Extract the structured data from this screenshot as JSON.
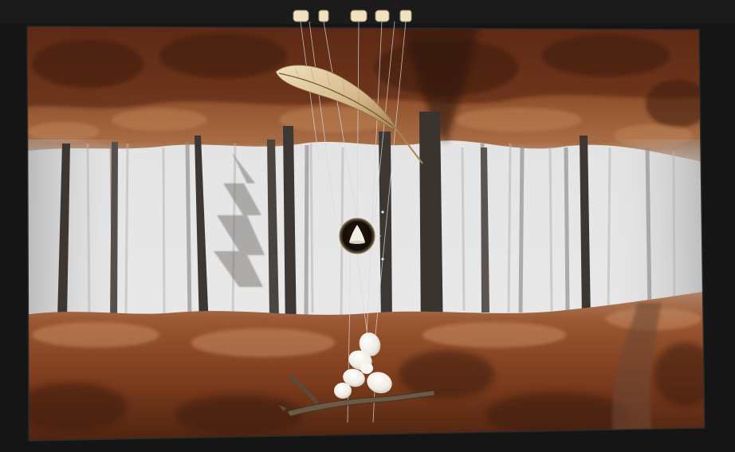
{
  "image": {
    "colors": {
      "background": "#151515",
      "fern_dark": "#4a1f0e",
      "fern_mid": "#8a4a26",
      "fern_light": "#c98a5a",
      "mist": "#e6e6e6",
      "mist_shadow": "#b8b8b8",
      "trunk": "#3a3531",
      "feather": "#d9c39a",
      "porcelain": "#f4f1ea",
      "branch": "#6b5a45",
      "cord": "#d8d8d8"
    },
    "icons": [
      "feather-icon",
      "porcelain-cluster-icon",
      "oculus-icon",
      "hanging-pegs-icon"
    ]
  }
}
